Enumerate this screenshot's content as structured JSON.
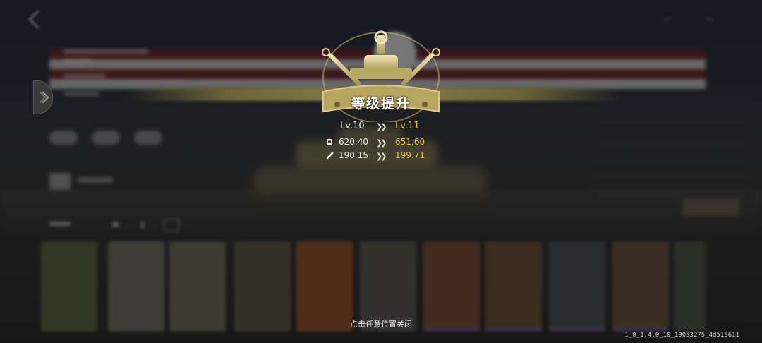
{
  "popup": {
    "title": "等级提升",
    "level_old": "Lv.10",
    "level_new": "Lv.11",
    "stats": [
      {
        "icon": "armor-shield-icon",
        "old": "620.40",
        "new": "651.60"
      },
      {
        "icon": "wrench-attack-icon",
        "old": "190.15",
        "new": "199.71"
      }
    ],
    "close_hint": "点击任意位置关闭"
  },
  "colors": {
    "gold": "#e8c13d",
    "badge": "#c9b46a",
    "overlay": "#1a1a1a"
  },
  "version": "1_0_1.4.0_10_10053275_4d515611"
}
